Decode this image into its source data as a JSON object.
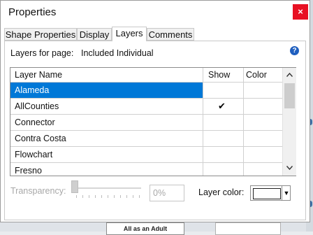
{
  "window": {
    "title": "Properties",
    "close_glyph": "×"
  },
  "tabs": [
    {
      "label": "Shape Properties"
    },
    {
      "label": "Display"
    },
    {
      "label": "Layers"
    },
    {
      "label": "Comments"
    }
  ],
  "active_tab": "Layers",
  "layers_for_page": {
    "label": "Layers for page:",
    "value": "Included Individual"
  },
  "help_glyph": "?",
  "table": {
    "columns": [
      "Layer Name",
      "Show",
      "Color"
    ],
    "rows": [
      {
        "name": "Alameda",
        "show": false,
        "selected": true
      },
      {
        "name": "AllCounties",
        "show": true,
        "selected": false
      },
      {
        "name": "Connector",
        "show": false,
        "selected": false
      },
      {
        "name": "Contra Costa",
        "show": false,
        "selected": false
      },
      {
        "name": "Flowchart",
        "show": false,
        "selected": false
      },
      {
        "name": "Fresno",
        "show": false,
        "selected": false
      }
    ],
    "check_glyph": "✔",
    "scroll_up_glyph": "▲",
    "scroll_down_glyph": "▼"
  },
  "transparency": {
    "label": "Transparency:",
    "value": "0%",
    "fraction": 0
  },
  "layer_color": {
    "label": "Layer color:",
    "value": "#ffffff",
    "dropdown_glyph": "▼"
  },
  "background": {
    "visible_text": "All as an Adult"
  }
}
